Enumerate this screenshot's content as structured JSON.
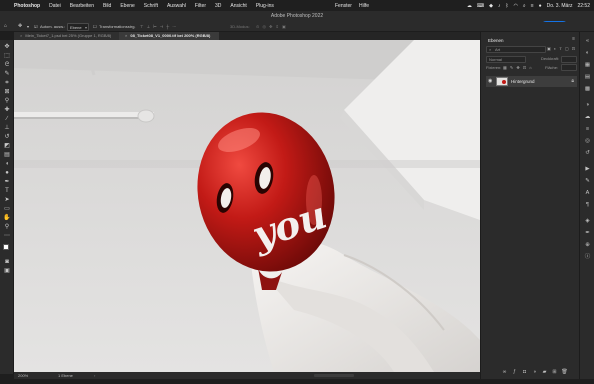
{
  "menubar": {
    "items": [
      "Photoshop",
      "Datei",
      "Bearbeiten",
      "Bild",
      "Ebene",
      "Schrift",
      "Auswahl",
      "Filter",
      "3D",
      "Ansicht",
      "Plug-ins",
      "Fenster",
      "Hilfe"
    ],
    "date": "Do. 3. März",
    "time": "22:52"
  },
  "window": {
    "title": "Adobe Photoshop 2022"
  },
  "share_button": {
    "label": "Teilen"
  },
  "options_bar": {
    "auto_select_label": "Autom. ausw.:",
    "auto_select_value": "Ebene",
    "transform_label": "Transformationsstrg.",
    "mode_label": "3D-Modus:"
  },
  "tabs": [
    {
      "label": "Mein_Ticket7_1.psd bei 25% (Gruppe 1, RGB/8)",
      "active": false
    },
    {
      "label": "08_Ticket08_V1_0000.tif bei 200% (RGB/8)",
      "active": true
    }
  ],
  "status_bar": {
    "zoom": "200%",
    "dimensions": "1 Ebene"
  },
  "layers_panel": {
    "tab": "Ebenen",
    "search_placeholder": "Art",
    "blend_mode": "Normal",
    "opacity_label": "Deckkraft:",
    "lock_label": "Fixieren:",
    "fill_label": "Fläche:",
    "layer_name": "Hintergrund"
  },
  "canvas": {
    "text_overlay": "you",
    "colors": {
      "balloon": "#c21a16",
      "background": "#dedcda",
      "cloth": "#f1efed"
    }
  }
}
